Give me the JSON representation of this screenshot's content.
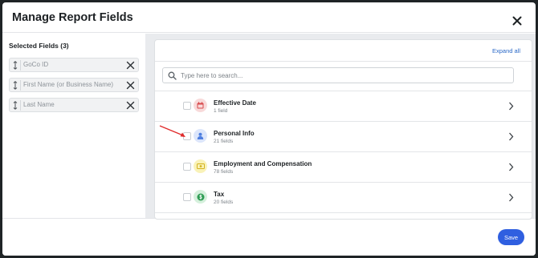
{
  "modal": {
    "title": "Manage Report Fields"
  },
  "selected": {
    "heading": "Selected Fields (3)",
    "fields": [
      {
        "label": "GoCo ID"
      },
      {
        "label": "First Name (or Business Name)"
      },
      {
        "label": "Last Name"
      }
    ]
  },
  "available": {
    "expand_all": "Expand all",
    "search_placeholder": "Type here to search...",
    "categories": [
      {
        "name": "Effective Date",
        "count": "1 field",
        "icon": "calendar-icon",
        "icon_bg": "#f8dada",
        "icon_fg": "#d8484a"
      },
      {
        "name": "Personal Info",
        "count": "21 fields",
        "icon": "person-icon",
        "icon_bg": "#dce6fb",
        "icon_fg": "#4f7fe0"
      },
      {
        "name": "Employment and Compensation",
        "count": "78 fields",
        "icon": "money-icon",
        "icon_bg": "#f9f2b8",
        "icon_fg": "#d4b21d"
      },
      {
        "name": "Tax",
        "count": "20 fields",
        "icon": "dollar-icon",
        "icon_bg": "#d5f0dc",
        "icon_fg": "#2f9d54"
      }
    ]
  },
  "footer": {
    "save_label": "Save"
  },
  "colors": {
    "accent": "#2f5fe0",
    "link": "#2a69c7",
    "annotation_arrow": "#e02a2a"
  }
}
